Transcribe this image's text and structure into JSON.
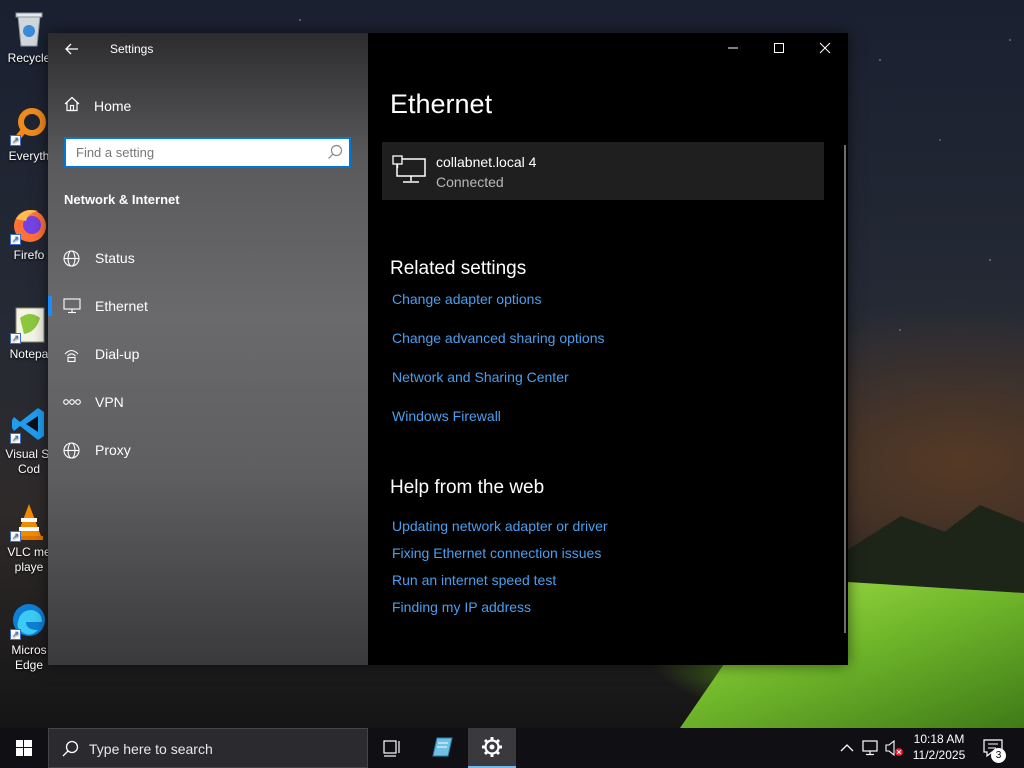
{
  "desktop": {
    "icons": [
      {
        "label": "Recycle",
        "icon": "recycle-bin-icon"
      },
      {
        "label": "Everyth",
        "icon": "everything-search-icon"
      },
      {
        "label": "Firefo",
        "icon": "firefox-icon"
      },
      {
        "label": "Notepa",
        "icon": "notepad-plus-plus-icon"
      },
      {
        "label": "Visual St",
        "label2": "Cod",
        "icon": "vscode-icon"
      },
      {
        "label": "VLC me",
        "label2": "playe",
        "icon": "vlc-icon"
      },
      {
        "label": "Micros",
        "label2": "Edge",
        "icon": "edge-icon"
      }
    ]
  },
  "window": {
    "app_title": "Settings",
    "controls": {
      "minimize": "—",
      "maximize": "☐",
      "close": "✕"
    }
  },
  "sidebar": {
    "home_label": "Home",
    "search_placeholder": "Find a setting",
    "section_title": "Network & Internet",
    "items": [
      {
        "label": "Status",
        "icon": "globe-icon"
      },
      {
        "label": "Ethernet",
        "icon": "monitor-icon",
        "selected": true
      },
      {
        "label": "Dial-up",
        "icon": "dialup-icon"
      },
      {
        "label": "VPN",
        "icon": "vpn-icon"
      },
      {
        "label": "Proxy",
        "icon": "globe-icon"
      }
    ]
  },
  "main": {
    "page_title": "Ethernet",
    "connection": {
      "name": "collabnet.local 4",
      "status": "Connected"
    },
    "related_title": "Related settings",
    "related_links": [
      "Change adapter options",
      "Change advanced sharing options",
      "Network and Sharing Center",
      "Windows Firewall"
    ],
    "help_title": "Help from the web",
    "help_links": [
      "Updating network adapter or driver",
      "Fixing Ethernet connection issues",
      "Run an internet speed test",
      "Finding my IP address"
    ]
  },
  "taskbar": {
    "search_placeholder": "Type here to search",
    "clock_time": "10:18 AM",
    "clock_date": "11/2/2025",
    "notification_count": "3"
  },
  "colors": {
    "accent": "#0078d7",
    "link": "#4a9fee",
    "main_bg": "#000000",
    "card_bg": "#1f1f1f"
  }
}
